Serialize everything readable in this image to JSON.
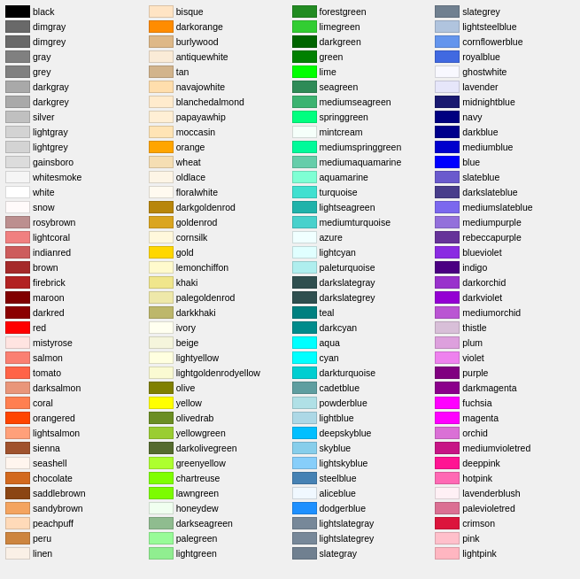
{
  "columns": [
    [
      {
        "name": "black",
        "color": "#000000"
      },
      {
        "name": "dimgray",
        "color": "#696969"
      },
      {
        "name": "dimgrey",
        "color": "#696969"
      },
      {
        "name": "gray",
        "color": "#808080"
      },
      {
        "name": "grey",
        "color": "#808080"
      },
      {
        "name": "darkgray",
        "color": "#a9a9a9"
      },
      {
        "name": "darkgrey",
        "color": "#a9a9a9"
      },
      {
        "name": "silver",
        "color": "#c0c0c0"
      },
      {
        "name": "lightgray",
        "color": "#d3d3d3"
      },
      {
        "name": "lightgrey",
        "color": "#d3d3d3"
      },
      {
        "name": "gainsboro",
        "color": "#dcdcdc"
      },
      {
        "name": "whitesmoke",
        "color": "#f5f5f5"
      },
      {
        "name": "white",
        "color": "#ffffff"
      },
      {
        "name": "snow",
        "color": "#fffafa"
      },
      {
        "name": "rosybrown",
        "color": "#bc8f8f"
      },
      {
        "name": "lightcoral",
        "color": "#f08080"
      },
      {
        "name": "indianred",
        "color": "#cd5c5c"
      },
      {
        "name": "brown",
        "color": "#a52a2a"
      },
      {
        "name": "firebrick",
        "color": "#b22222"
      },
      {
        "name": "maroon",
        "color": "#800000"
      },
      {
        "name": "darkred",
        "color": "#8b0000"
      },
      {
        "name": "red",
        "color": "#ff0000"
      },
      {
        "name": "mistyrose",
        "color": "#ffe4e1"
      },
      {
        "name": "salmon",
        "color": "#fa8072"
      },
      {
        "name": "tomato",
        "color": "#ff6347"
      },
      {
        "name": "darksalmon",
        "color": "#e9967a"
      },
      {
        "name": "coral",
        "color": "#ff7f50"
      },
      {
        "name": "orangered",
        "color": "#ff4500"
      },
      {
        "name": "lightsalmon",
        "color": "#ffa07a"
      },
      {
        "name": "sienna",
        "color": "#a0522d"
      },
      {
        "name": "seashell",
        "color": "#fff5ee"
      },
      {
        "name": "chocolate",
        "color": "#d2691e"
      },
      {
        "name": "saddlebrown",
        "color": "#8b4513"
      },
      {
        "name": "sandybrown",
        "color": "#f4a460"
      },
      {
        "name": "peachpuff",
        "color": "#ffdab9"
      },
      {
        "name": "peru",
        "color": "#cd853f"
      },
      {
        "name": "linen",
        "color": "#faf0e6"
      }
    ],
    [
      {
        "name": "bisque",
        "color": "#ffe4c4"
      },
      {
        "name": "darkorange",
        "color": "#ff8c00"
      },
      {
        "name": "burlywood",
        "color": "#deb887"
      },
      {
        "name": "antiquewhite",
        "color": "#faebd7"
      },
      {
        "name": "tan",
        "color": "#d2b48c"
      },
      {
        "name": "navajowhite",
        "color": "#ffdead"
      },
      {
        "name": "blanchedalmond",
        "color": "#ffebcd"
      },
      {
        "name": "papayawhip",
        "color": "#ffefd5"
      },
      {
        "name": "moccasin",
        "color": "#ffe4b5"
      },
      {
        "name": "orange",
        "color": "#ffa500"
      },
      {
        "name": "wheat",
        "color": "#f5deb3"
      },
      {
        "name": "oldlace",
        "color": "#fdf5e6"
      },
      {
        "name": "floralwhite",
        "color": "#fffaf0"
      },
      {
        "name": "darkgoldenrod",
        "color": "#b8860b"
      },
      {
        "name": "goldenrod",
        "color": "#daa520"
      },
      {
        "name": "cornsilk",
        "color": "#fff8dc"
      },
      {
        "name": "gold",
        "color": "#ffd700"
      },
      {
        "name": "lemonchiffon",
        "color": "#fffacd"
      },
      {
        "name": "khaki",
        "color": "#f0e68c"
      },
      {
        "name": "palegoldenrod",
        "color": "#eee8aa"
      },
      {
        "name": "darkkhaki",
        "color": "#bdb76b"
      },
      {
        "name": "ivory",
        "color": "#fffff0"
      },
      {
        "name": "beige",
        "color": "#f5f5dc"
      },
      {
        "name": "lightyellow",
        "color": "#ffffe0"
      },
      {
        "name": "lightgoldenrodyellow",
        "color": "#fafad2"
      },
      {
        "name": "olive",
        "color": "#808000"
      },
      {
        "name": "yellow",
        "color": "#ffff00"
      },
      {
        "name": "olivedrab",
        "color": "#6b8e23"
      },
      {
        "name": "yellowgreen",
        "color": "#9acd32"
      },
      {
        "name": "darkolivegreen",
        "color": "#556b2f"
      },
      {
        "name": "greenyellow",
        "color": "#adff2f"
      },
      {
        "name": "chartreuse",
        "color": "#7fff00"
      },
      {
        "name": "lawngreen",
        "color": "#7cfc00"
      },
      {
        "name": "honeydew",
        "color": "#f0fff0"
      },
      {
        "name": "darkseagreen",
        "color": "#8fbc8f"
      },
      {
        "name": "palegreen",
        "color": "#98fb98"
      },
      {
        "name": "lightgreen",
        "color": "#90ee90"
      }
    ],
    [
      {
        "name": "forestgreen",
        "color": "#228b22"
      },
      {
        "name": "limegreen",
        "color": "#32cd32"
      },
      {
        "name": "darkgreen",
        "color": "#006400"
      },
      {
        "name": "green",
        "color": "#008000"
      },
      {
        "name": "lime",
        "color": "#00ff00"
      },
      {
        "name": "seagreen",
        "color": "#2e8b57"
      },
      {
        "name": "mediumseagreen",
        "color": "#3cb371"
      },
      {
        "name": "springgreen",
        "color": "#00ff7f"
      },
      {
        "name": "mintcream",
        "color": "#f5fffa"
      },
      {
        "name": "mediumspringgreen",
        "color": "#00fa9a"
      },
      {
        "name": "mediumaquamarine",
        "color": "#66cdaa"
      },
      {
        "name": "aquamarine",
        "color": "#7fffd4"
      },
      {
        "name": "turquoise",
        "color": "#40e0d0"
      },
      {
        "name": "lightseagreen",
        "color": "#20b2aa"
      },
      {
        "name": "mediumturquoise",
        "color": "#48d1cc"
      },
      {
        "name": "azure",
        "color": "#f0ffff"
      },
      {
        "name": "lightcyan",
        "color": "#e0ffff"
      },
      {
        "name": "paleturquoise",
        "color": "#afeeee"
      },
      {
        "name": "darkslategray",
        "color": "#2f4f4f"
      },
      {
        "name": "darkslategrey",
        "color": "#2f4f4f"
      },
      {
        "name": "teal",
        "color": "#008080"
      },
      {
        "name": "darkcyan",
        "color": "#008b8b"
      },
      {
        "name": "aqua",
        "color": "#00ffff"
      },
      {
        "name": "cyan",
        "color": "#00ffff"
      },
      {
        "name": "darkturquoise",
        "color": "#00ced1"
      },
      {
        "name": "cadetblue",
        "color": "#5f9ea0"
      },
      {
        "name": "powderblue",
        "color": "#b0e0e6"
      },
      {
        "name": "lightblue",
        "color": "#add8e6"
      },
      {
        "name": "deepskyblue",
        "color": "#00bfff"
      },
      {
        "name": "skyblue",
        "color": "#87ceeb"
      },
      {
        "name": "lightskyblue",
        "color": "#87cefa"
      },
      {
        "name": "steelblue",
        "color": "#4682b4"
      },
      {
        "name": "aliceblue",
        "color": "#f0f8ff"
      },
      {
        "name": "dodgerblue",
        "color": "#1e90ff"
      },
      {
        "name": "lightslategray",
        "color": "#778899"
      },
      {
        "name": "lightslategrey",
        "color": "#778899"
      },
      {
        "name": "slategray",
        "color": "#708090"
      }
    ],
    [
      {
        "name": "slategrey",
        "color": "#708090"
      },
      {
        "name": "lightsteelblue",
        "color": "#b0c4de"
      },
      {
        "name": "cornflowerblue",
        "color": "#6495ed"
      },
      {
        "name": "royalblue",
        "color": "#4169e1"
      },
      {
        "name": "ghostwhite",
        "color": "#f8f8ff"
      },
      {
        "name": "lavender",
        "color": "#e6e6fa"
      },
      {
        "name": "midnightblue",
        "color": "#191970"
      },
      {
        "name": "navy",
        "color": "#000080"
      },
      {
        "name": "darkblue",
        "color": "#00008b"
      },
      {
        "name": "mediumblue",
        "color": "#0000cd"
      },
      {
        "name": "blue",
        "color": "#0000ff"
      },
      {
        "name": "slateblue",
        "color": "#6a5acd"
      },
      {
        "name": "darkslateblue",
        "color": "#483d8b"
      },
      {
        "name": "mediumslateblue",
        "color": "#7b68ee"
      },
      {
        "name": "mediumpurple",
        "color": "#9370db"
      },
      {
        "name": "rebeccapurple",
        "color": "#663399"
      },
      {
        "name": "blueviolet",
        "color": "#8a2be2"
      },
      {
        "name": "indigo",
        "color": "#4b0082"
      },
      {
        "name": "darkorchid",
        "color": "#9932cc"
      },
      {
        "name": "darkviolet",
        "color": "#9400d3"
      },
      {
        "name": "mediumorchid",
        "color": "#ba55d3"
      },
      {
        "name": "thistle",
        "color": "#d8bfd8"
      },
      {
        "name": "plum",
        "color": "#dda0dd"
      },
      {
        "name": "violet",
        "color": "#ee82ee"
      },
      {
        "name": "purple",
        "color": "#800080"
      },
      {
        "name": "darkmagenta",
        "color": "#8b008b"
      },
      {
        "name": "fuchsia",
        "color": "#ff00ff"
      },
      {
        "name": "magenta",
        "color": "#ff00ff"
      },
      {
        "name": "orchid",
        "color": "#da70d6"
      },
      {
        "name": "mediumvioletred",
        "color": "#c71585"
      },
      {
        "name": "deeppink",
        "color": "#ff1493"
      },
      {
        "name": "hotpink",
        "color": "#ff69b4"
      },
      {
        "name": "lavenderblush",
        "color": "#fff0f5"
      },
      {
        "name": "palevioletred",
        "color": "#db7093"
      },
      {
        "name": "crimson",
        "color": "#dc143c"
      },
      {
        "name": "pink",
        "color": "#ffc0cb"
      },
      {
        "name": "lightpink",
        "color": "#ffb6c1"
      }
    ]
  ]
}
